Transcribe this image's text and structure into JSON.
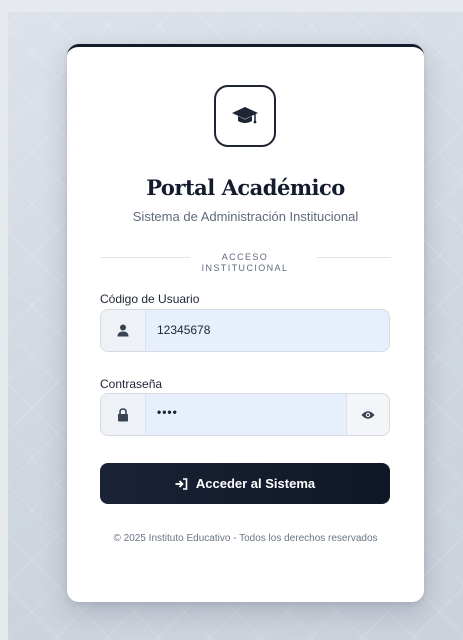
{
  "app": {
    "title": "Portal Académico",
    "subtitle": "Sistema de Administración Institucional",
    "logo_icon": "graduation-cap-icon"
  },
  "section": {
    "label": "ACCESO INSTITUCIONAL"
  },
  "form": {
    "username": {
      "label": "Código de Usuario",
      "value": "12345678",
      "icon": "user-icon"
    },
    "password": {
      "label": "Contraseña",
      "value": "••••",
      "icon": "lock-icon",
      "toggle_icon": "eye-icon"
    },
    "submit": {
      "label": "Acceder al Sistema",
      "icon": "sign-in-icon"
    }
  },
  "footer": {
    "text": "© 2025 Instituto Educativo - Todos los derechos reservados"
  },
  "colors": {
    "primary": "#141b2d",
    "input_bg": "#e8effc",
    "muted_text": "#5f6b7c",
    "page_bg": "#e6e9ee"
  }
}
